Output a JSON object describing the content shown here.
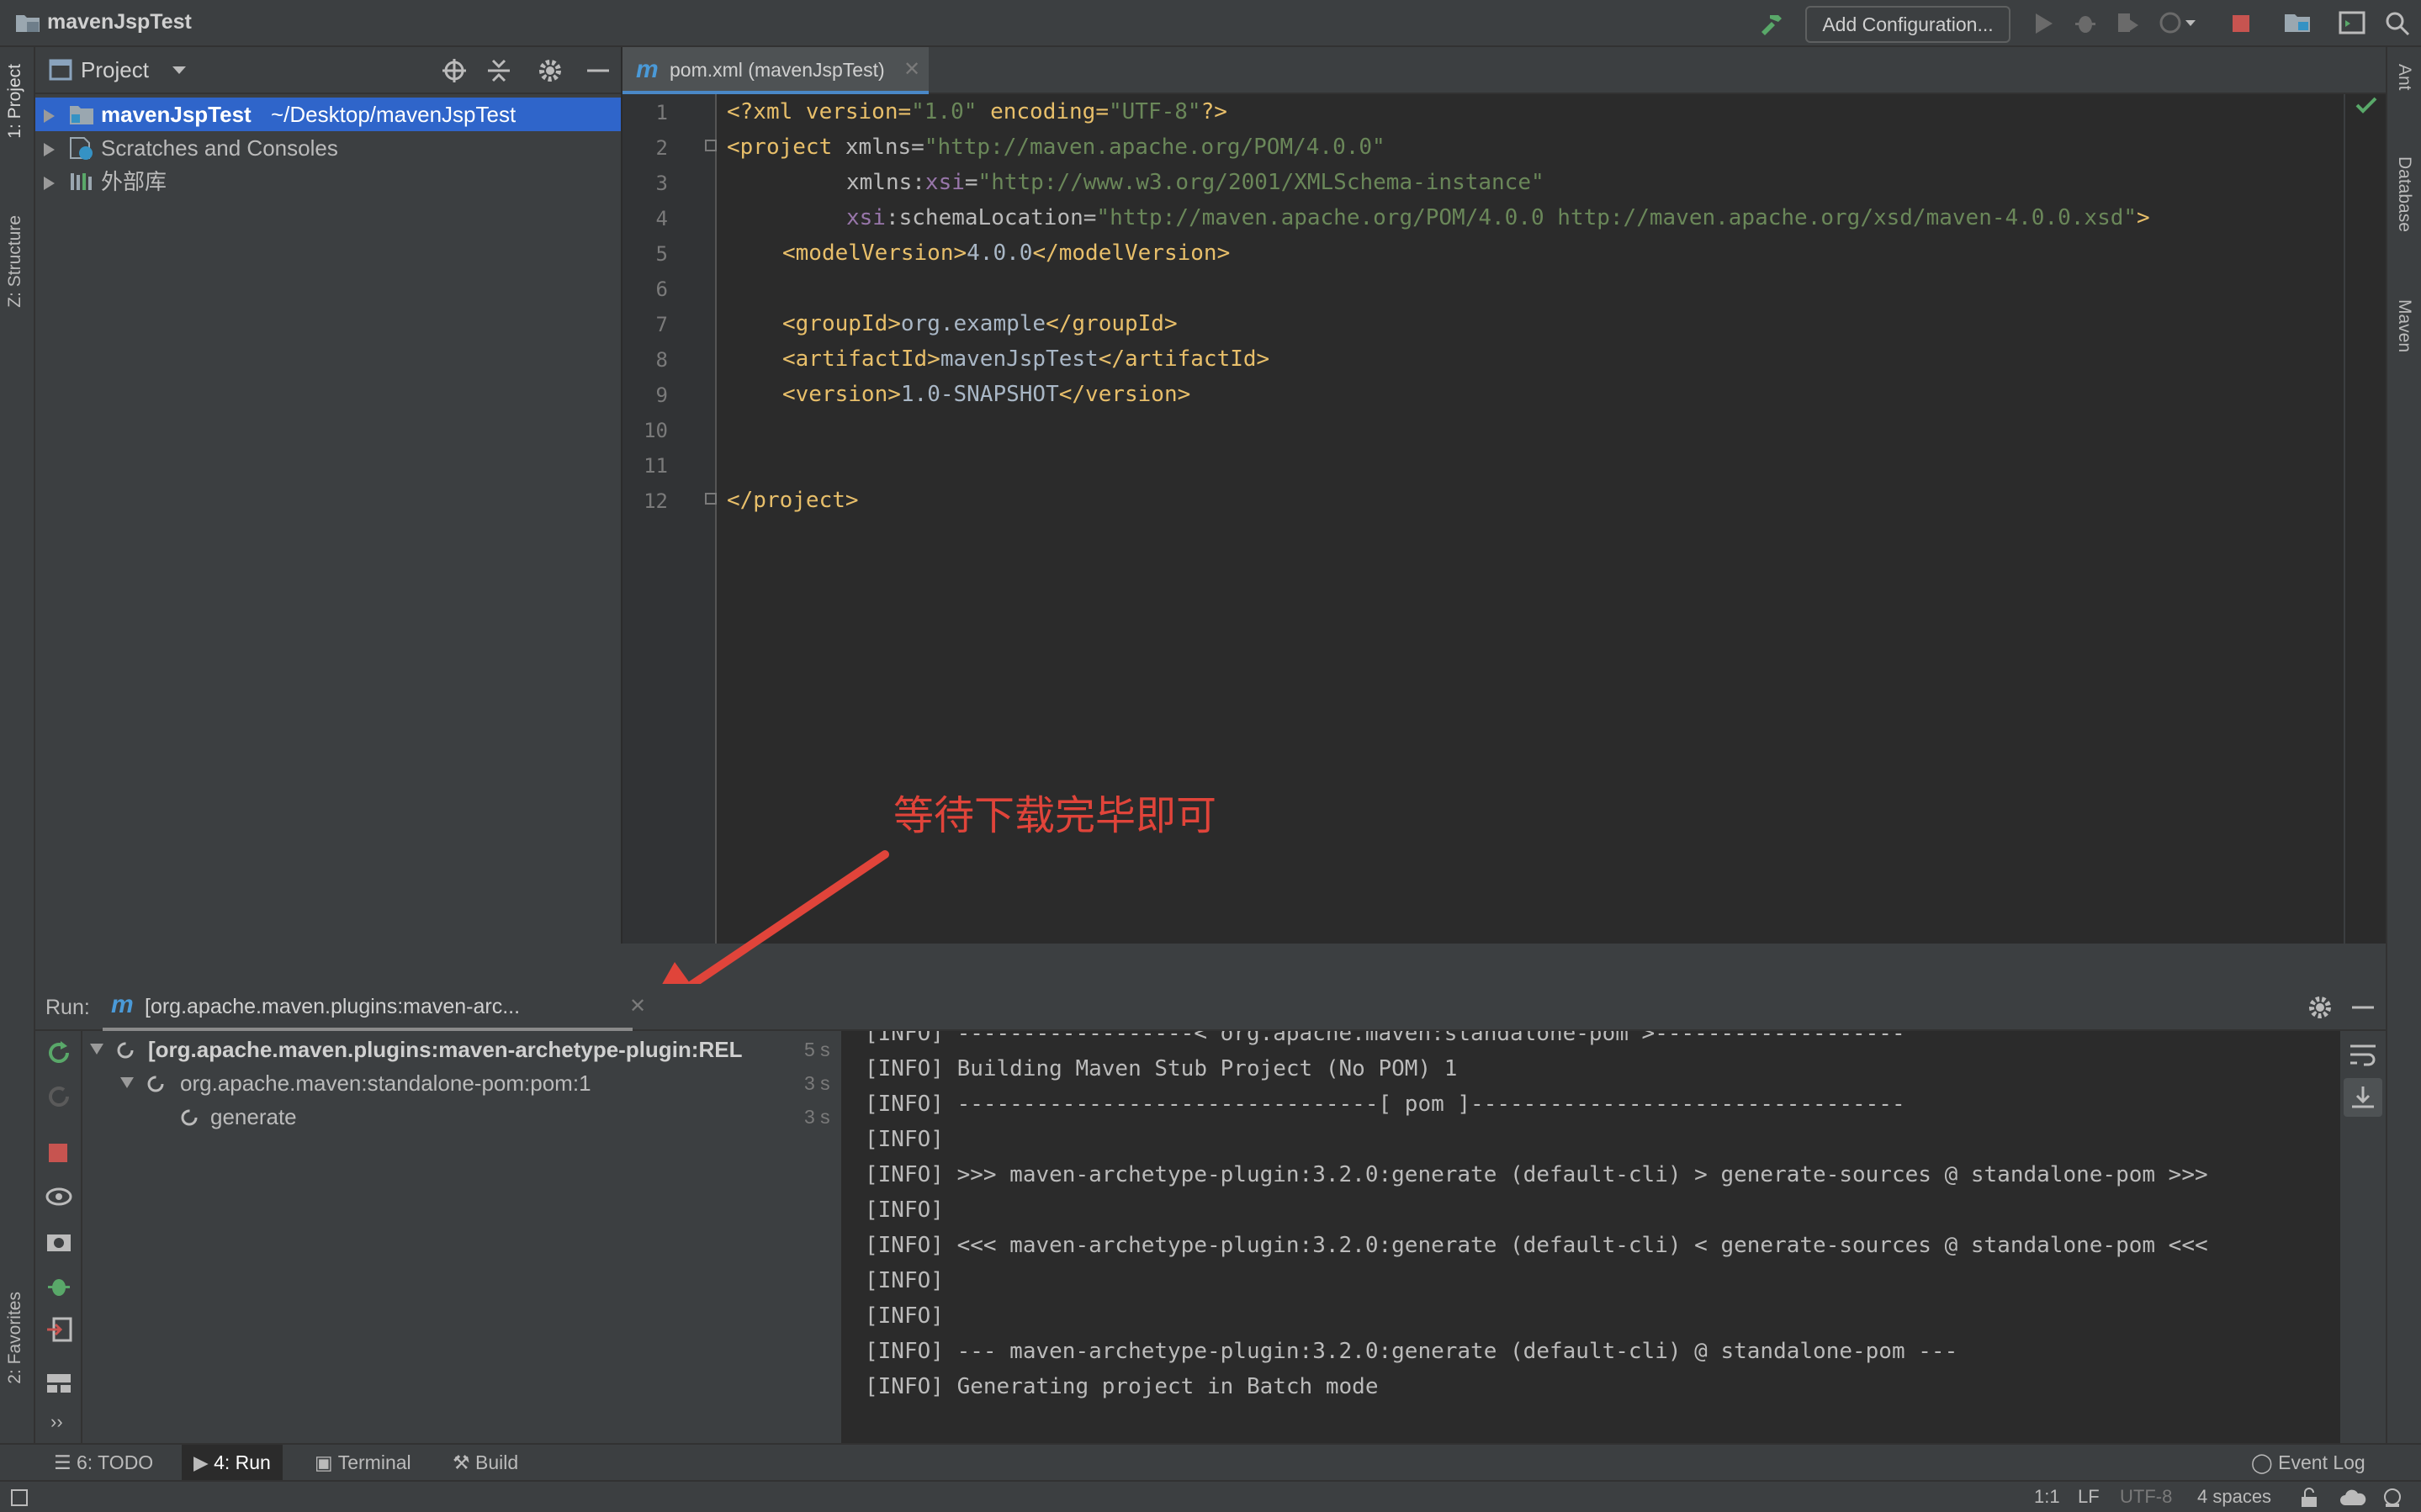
{
  "window": {
    "title": "mavenJspTest"
  },
  "toolbar": {
    "add_config": "Add Configuration..."
  },
  "left_strip": {
    "project": "1: Project",
    "structure": "Z: Structure",
    "favorites": "2: Favorites"
  },
  "right_strip": {
    "ant": "Ant",
    "database": "Database",
    "maven": "Maven"
  },
  "project_panel": {
    "title": "Project",
    "tree": [
      {
        "name": "mavenJspTest",
        "path": "~/Desktop/mavenJspTest"
      },
      {
        "name": "Scratches and Consoles"
      },
      {
        "name": "外部库"
      }
    ]
  },
  "editor": {
    "tab": "pom.xml (mavenJspTest)",
    "lines": [
      "1",
      "2",
      "3",
      "4",
      "5",
      "6",
      "7",
      "8",
      "9",
      "10",
      "11",
      "12"
    ],
    "code": {
      "l1_a": "<?xml version=",
      "l1_b": "\"1.0\"",
      "l1_c": " encoding=",
      "l1_d": "\"UTF-8\"",
      "l1_e": "?>",
      "l2_a": "<project",
      "l2_b": " xmlns=",
      "l2_c": "\"http://maven.apache.org/POM/4.0.0\"",
      "l3_a": "xmlns:",
      "l3_b": "xsi",
      "l3_c": "=",
      "l3_d": "\"http://www.w3.org/2001/XMLSchema-instance\"",
      "l4_a": "xsi",
      "l4_b": ":schemaLocation=",
      "l4_c": "\"http://maven.apache.org/POM/4.0.0 http://maven.apache.org/xsd/maven-4.0.0.xsd\"",
      "l4_d": ">",
      "l5_a": "<modelVersion>",
      "l5_b": "4.0.0",
      "l5_c": "</modelVersion>",
      "l7_a": "<groupId>",
      "l7_b": "org.example",
      "l7_c": "</groupId>",
      "l8_a": "<artifactId>",
      "l8_b": "mavenJspTest",
      "l8_c": "</artifactId>",
      "l9_a": "<version>",
      "l9_b": "1.0-SNAPSHOT",
      "l9_c": "</version>",
      "l12_a": "</project>"
    }
  },
  "annotation": {
    "text": "等待下载完毕即可"
  },
  "run_panel": {
    "label": "Run:",
    "tab": "[org.apache.maven.plugins:maven-arc...",
    "tree": [
      {
        "label": "[org.apache.maven.plugins:maven-archetype-plugin:REL",
        "time": "5 s"
      },
      {
        "label": "org.apache.maven:standalone-pom:pom:1",
        "time": "3 s"
      },
      {
        "label": "generate",
        "time": "3 s"
      }
    ],
    "console": [
      "[INFO] ------------------< org.apache.maven:standalone-pom >-------------------",
      "[INFO] Building Maven Stub Project (No POM) 1",
      "[INFO] --------------------------------[ pom ]---------------------------------",
      "[INFO]",
      "[INFO] >>> maven-archetype-plugin:3.2.0:generate (default-cli) > generate-sources @ standalone-pom >>>",
      "[INFO]",
      "[INFO] <<< maven-archetype-plugin:3.2.0:generate (default-cli) < generate-sources @ standalone-pom <<<",
      "[INFO]",
      "[INFO]",
      "[INFO] --- maven-archetype-plugin:3.2.0:generate (default-cli) @ standalone-pom ---",
      "[INFO] Generating project in Batch mode"
    ]
  },
  "bottom_tools": {
    "todo": "6: TODO",
    "run": "4: Run",
    "terminal": "Terminal",
    "build": "Build",
    "event_log": "Event Log"
  },
  "status": {
    "position": "1:1",
    "line_sep": "LF",
    "encoding": "UTF-8",
    "indent": "4 spaces"
  },
  "colors": {
    "accent": "#2f65ca",
    "annotation": "#e0443a",
    "tag": "#e8bf6a",
    "string": "#6a8759"
  }
}
